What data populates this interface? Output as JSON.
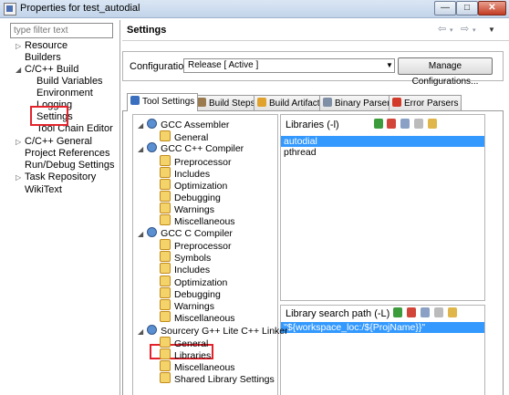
{
  "window": {
    "title": "Properties for test_autodial",
    "min": "—",
    "max": "□",
    "close": "✕"
  },
  "filter": {
    "placeholder": "type filter text"
  },
  "nav_tree": [
    {
      "label": "Resource",
      "twisty": "▷",
      "indent": 0
    },
    {
      "label": "Builders",
      "twisty": "",
      "indent": 0
    },
    {
      "label": "C/C++ Build",
      "twisty": "◢",
      "indent": 0
    },
    {
      "label": "Build Variables",
      "twisty": "",
      "indent": 1
    },
    {
      "label": "Environment",
      "twisty": "",
      "indent": 1
    },
    {
      "label": "Logging",
      "twisty": "",
      "indent": 1
    },
    {
      "label": "Settings",
      "twisty": "",
      "indent": 1
    },
    {
      "label": "Tool Chain Editor",
      "twisty": "",
      "indent": 1
    },
    {
      "label": "C/C++ General",
      "twisty": "▷",
      "indent": 0
    },
    {
      "label": "Project References",
      "twisty": "",
      "indent": 0
    },
    {
      "label": "Run/Debug Settings",
      "twisty": "",
      "indent": 0
    },
    {
      "label": "Task Repository",
      "twisty": "▷",
      "indent": 0
    },
    {
      "label": "WikiText",
      "twisty": "",
      "indent": 0
    }
  ],
  "header": {
    "title": "Settings"
  },
  "config": {
    "label": "Configuration:",
    "value": "Release  [ Active ]",
    "manage_label": "Manage Configurations..."
  },
  "tabs": [
    {
      "label": "Tool Settings",
      "color": "#3a6fc0"
    },
    {
      "label": "Build Steps",
      "color": "#9a7b4f"
    },
    {
      "label": "Build Artifact",
      "color": "#e0a22c"
    },
    {
      "label": "Binary Parsers",
      "color": "#7f8fa6"
    },
    {
      "label": "Error Parsers",
      "color": "#d23a2a"
    }
  ],
  "tool_tree": [
    {
      "label": "GCC Assembler",
      "kind": "tool"
    },
    {
      "label": "General",
      "kind": "option"
    },
    {
      "label": "GCC C++ Compiler",
      "kind": "tool"
    },
    {
      "label": "Preprocessor",
      "kind": "option"
    },
    {
      "label": "Includes",
      "kind": "option"
    },
    {
      "label": "Optimization",
      "kind": "option"
    },
    {
      "label": "Debugging",
      "kind": "option"
    },
    {
      "label": "Warnings",
      "kind": "option"
    },
    {
      "label": "Miscellaneous",
      "kind": "option"
    },
    {
      "label": "GCC C Compiler",
      "kind": "tool"
    },
    {
      "label": "Preprocessor",
      "kind": "option"
    },
    {
      "label": "Symbols",
      "kind": "option"
    },
    {
      "label": "Includes",
      "kind": "option"
    },
    {
      "label": "Optimization",
      "kind": "option"
    },
    {
      "label": "Debugging",
      "kind": "option"
    },
    {
      "label": "Warnings",
      "kind": "option"
    },
    {
      "label": "Miscellaneous",
      "kind": "option"
    },
    {
      "label": "Sourcery G++ Lite C++ Linker",
      "kind": "tool"
    },
    {
      "label": "General",
      "kind": "option"
    },
    {
      "label": "Libraries",
      "kind": "option"
    },
    {
      "label": "Miscellaneous",
      "kind": "option"
    },
    {
      "label": "Shared Library Settings",
      "kind": "option"
    }
  ],
  "libraries": {
    "header": "Libraries (-l)",
    "items": [
      "autodial",
      "pthread"
    ]
  },
  "library_paths": {
    "header": "Library search path (-L)",
    "items": [
      "\"${workspace_loc:/${ProjName}}\""
    ]
  },
  "toolbar_icons": [
    "add-icon",
    "delete-icon",
    "edit-icon",
    "move-up-icon",
    "move-down-icon"
  ],
  "colors": {
    "selection": "#3399ff",
    "highlight": "#e3232c"
  }
}
